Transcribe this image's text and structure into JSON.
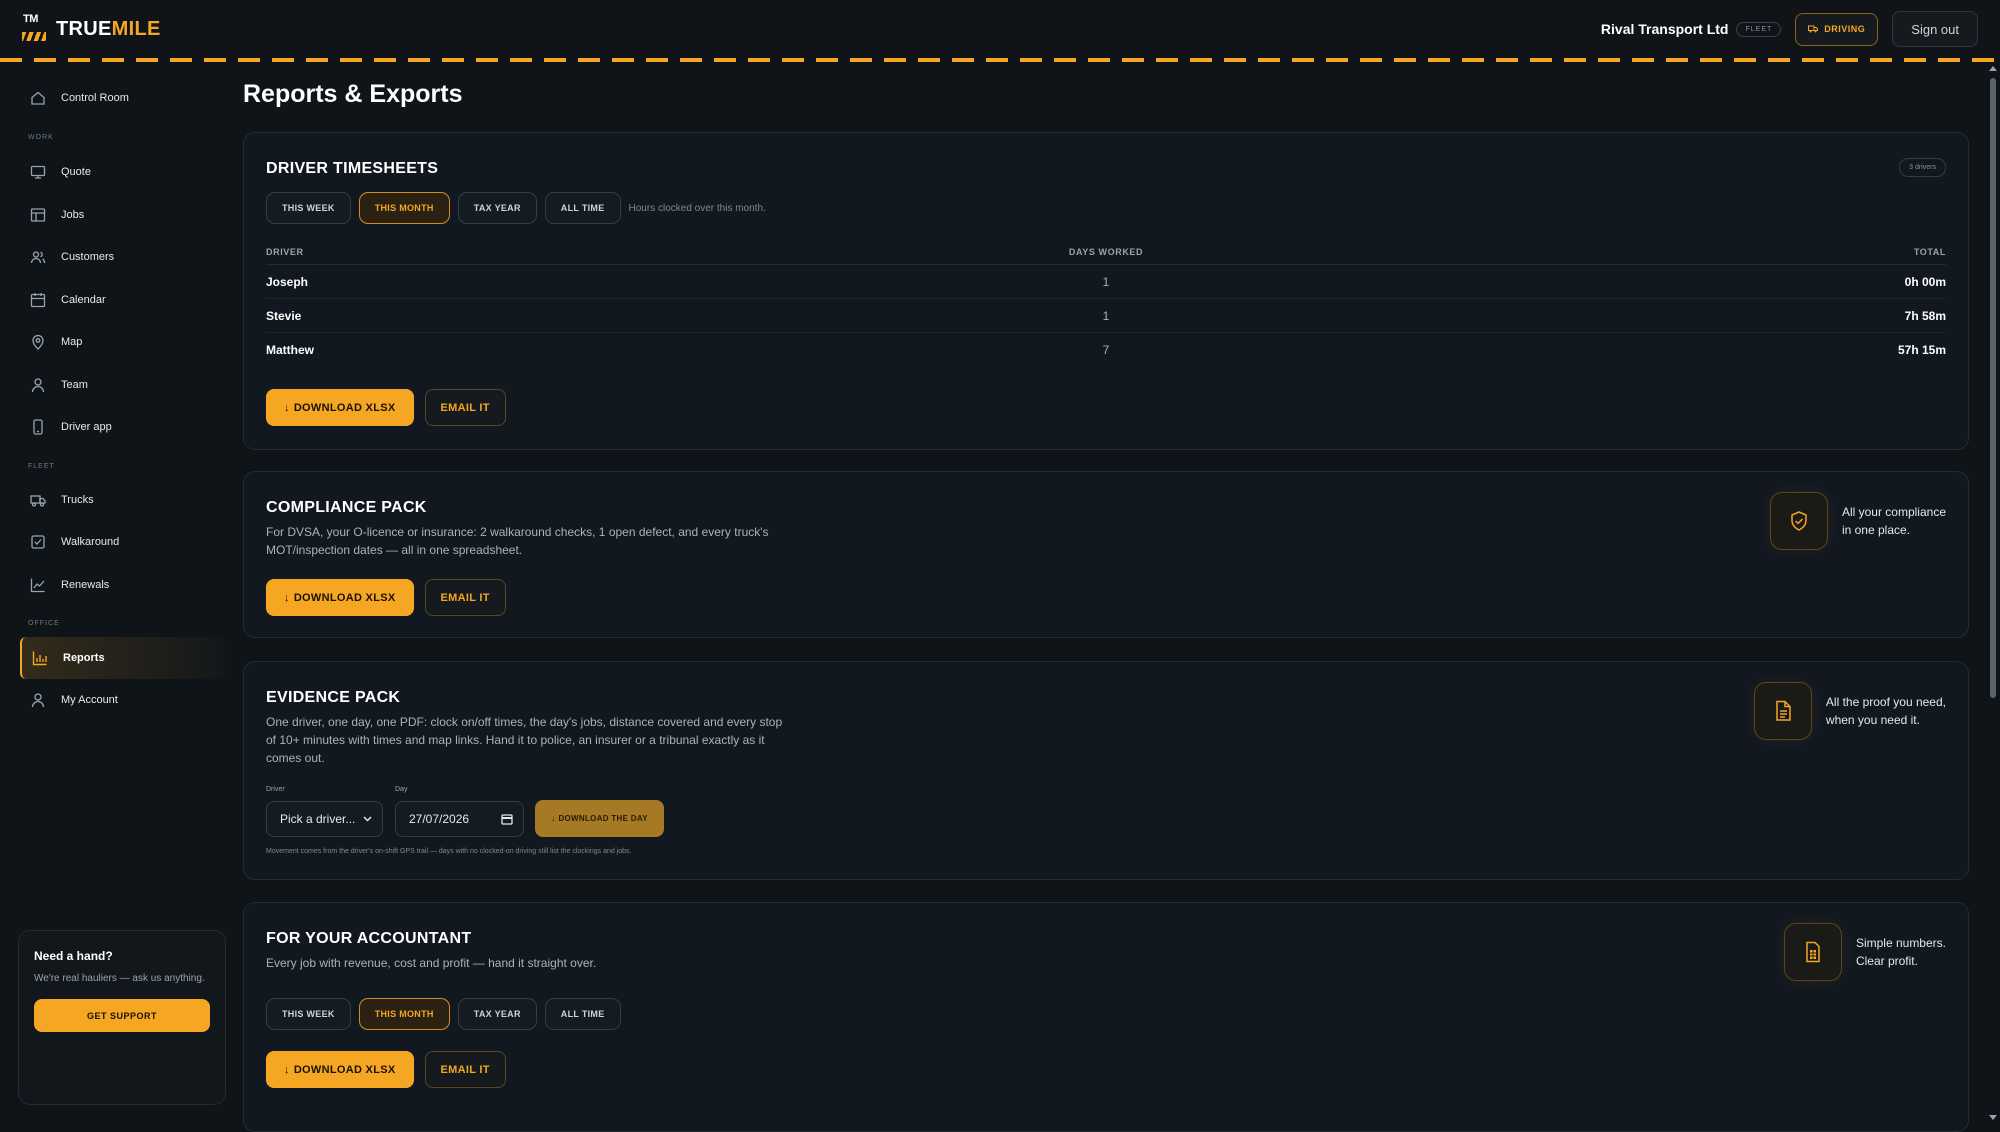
{
  "brand": {
    "mark": "TM",
    "name_part1": "TRUE",
    "name_part2": "MILE",
    "accent": "#f5a623"
  },
  "header": {
    "company": "Rival Transport Ltd",
    "plan_badge": "FLEET",
    "driving_label": "DRIVING",
    "signout_label": "Sign out"
  },
  "sidebar": {
    "items": [
      {
        "label": "Control Room",
        "icon": "home-icon"
      },
      {
        "label": "Quote",
        "icon": "monitor-icon"
      },
      {
        "label": "Jobs",
        "icon": "table-icon"
      },
      {
        "label": "Customers",
        "icon": "users-icon"
      },
      {
        "label": "Calendar",
        "icon": "calendar-icon"
      },
      {
        "label": "Map",
        "icon": "map-pin-icon"
      },
      {
        "label": "Team",
        "icon": "user-icon"
      },
      {
        "label": "Driver app",
        "icon": "phone-icon"
      },
      {
        "label": "Trucks",
        "icon": "truck-icon"
      },
      {
        "label": "Walkaround",
        "icon": "checkbox-icon"
      },
      {
        "label": "Renewals",
        "icon": "line-chart-icon"
      },
      {
        "label": "Reports",
        "icon": "bar-chart-icon"
      },
      {
        "label": "My Account",
        "icon": "account-icon"
      }
    ],
    "sections": {
      "work": "WORK",
      "fleet": "FLEET",
      "office": "OFFICE"
    },
    "help": {
      "title": "Need a hand?",
      "text": "We're real hauliers — ask us anything.",
      "button": "GET SUPPORT"
    }
  },
  "page": {
    "title": "Reports & Exports"
  },
  "timesheets": {
    "title": "DRIVER TIMESHEETS",
    "badge": "3 drivers",
    "periods": [
      "THIS WEEK",
      "THIS MONTH",
      "TAX YEAR",
      "ALL TIME"
    ],
    "active_period": "THIS MONTH",
    "hint": "Hours clocked over this month.",
    "columns": {
      "driver": "DRIVER",
      "days": "DAYS WORKED",
      "total": "TOTAL"
    },
    "rows": [
      {
        "driver": "Joseph",
        "days": "1",
        "total": "0h 00m"
      },
      {
        "driver": "Stevie",
        "days": "1",
        "total": "7h 58m"
      },
      {
        "driver": "Matthew",
        "days": "7",
        "total": "57h 15m"
      }
    ],
    "download": "DOWNLOAD XLSX",
    "email": "EMAIL IT"
  },
  "compliance": {
    "title": "COMPLIANCE PACK",
    "desc_line1": "For DVSA, your O-licence or insurance: 2 walkaround checks, 1 open defect, and every truck's",
    "desc_line2": "MOT/inspection dates — all in one spreadsheet.",
    "feature_line1": "All your compliance",
    "feature_line2": "in one place.",
    "download": "DOWNLOAD XLSX",
    "email": "EMAIL IT"
  },
  "evidence": {
    "title": "EVIDENCE PACK",
    "desc_line1": "One driver, one day, one PDF: clock on/off times, the day's jobs, distance covered and every stop",
    "desc_line2": "of 10+ minutes with times and map links. Hand it to police, an insurer or a tribunal exactly as it",
    "desc_line3": "comes out.",
    "driver_label": "Driver",
    "driver_value": "Pick a driver...",
    "day_label": "Day",
    "day_value": "27/07/2026",
    "download": "DOWNLOAD THE DAY",
    "fine_print": "Movement comes from the driver's on-shift GPS trail — days with no clocked-on driving still list the clockings and jobs.",
    "feature_line1": "All the proof you need,",
    "feature_line2": "when you need it."
  },
  "accountant": {
    "title": "FOR YOUR ACCOUNTANT",
    "desc": "Every job with revenue, cost and profit — hand it straight over.",
    "periods": [
      "THIS WEEK",
      "THIS MONTH",
      "TAX YEAR",
      "ALL TIME"
    ],
    "active_period": "THIS MONTH",
    "feature_line1": "Simple numbers.",
    "feature_line2": "Clear profit.",
    "download": "DOWNLOAD XLSX",
    "email": "EMAIL IT"
  }
}
